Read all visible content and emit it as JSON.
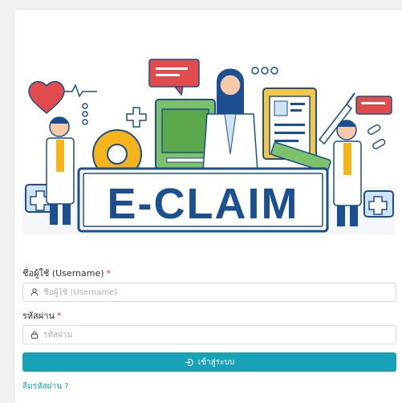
{
  "banner": {
    "title": "E-CLAIM"
  },
  "form": {
    "username_label": "ชื่อผู้ใช้ (Username)",
    "username_required": "*",
    "username_placeholder": "ชื่อผู้ใช้ (Username)",
    "password_label": "รหัสผ่าน",
    "password_required": "*",
    "password_placeholder": "รหัสผ่าน",
    "login_button": "เข้าสู่ระบบ",
    "forgot_link": "ลืมรหัสผ่าน ?"
  },
  "colors": {
    "accent": "#17a2b8",
    "required": "#e53935",
    "banner_blue": "#1c4f8f"
  },
  "icons": {
    "username": "user-icon",
    "password": "lock-icon",
    "login": "sign-in-icon"
  }
}
